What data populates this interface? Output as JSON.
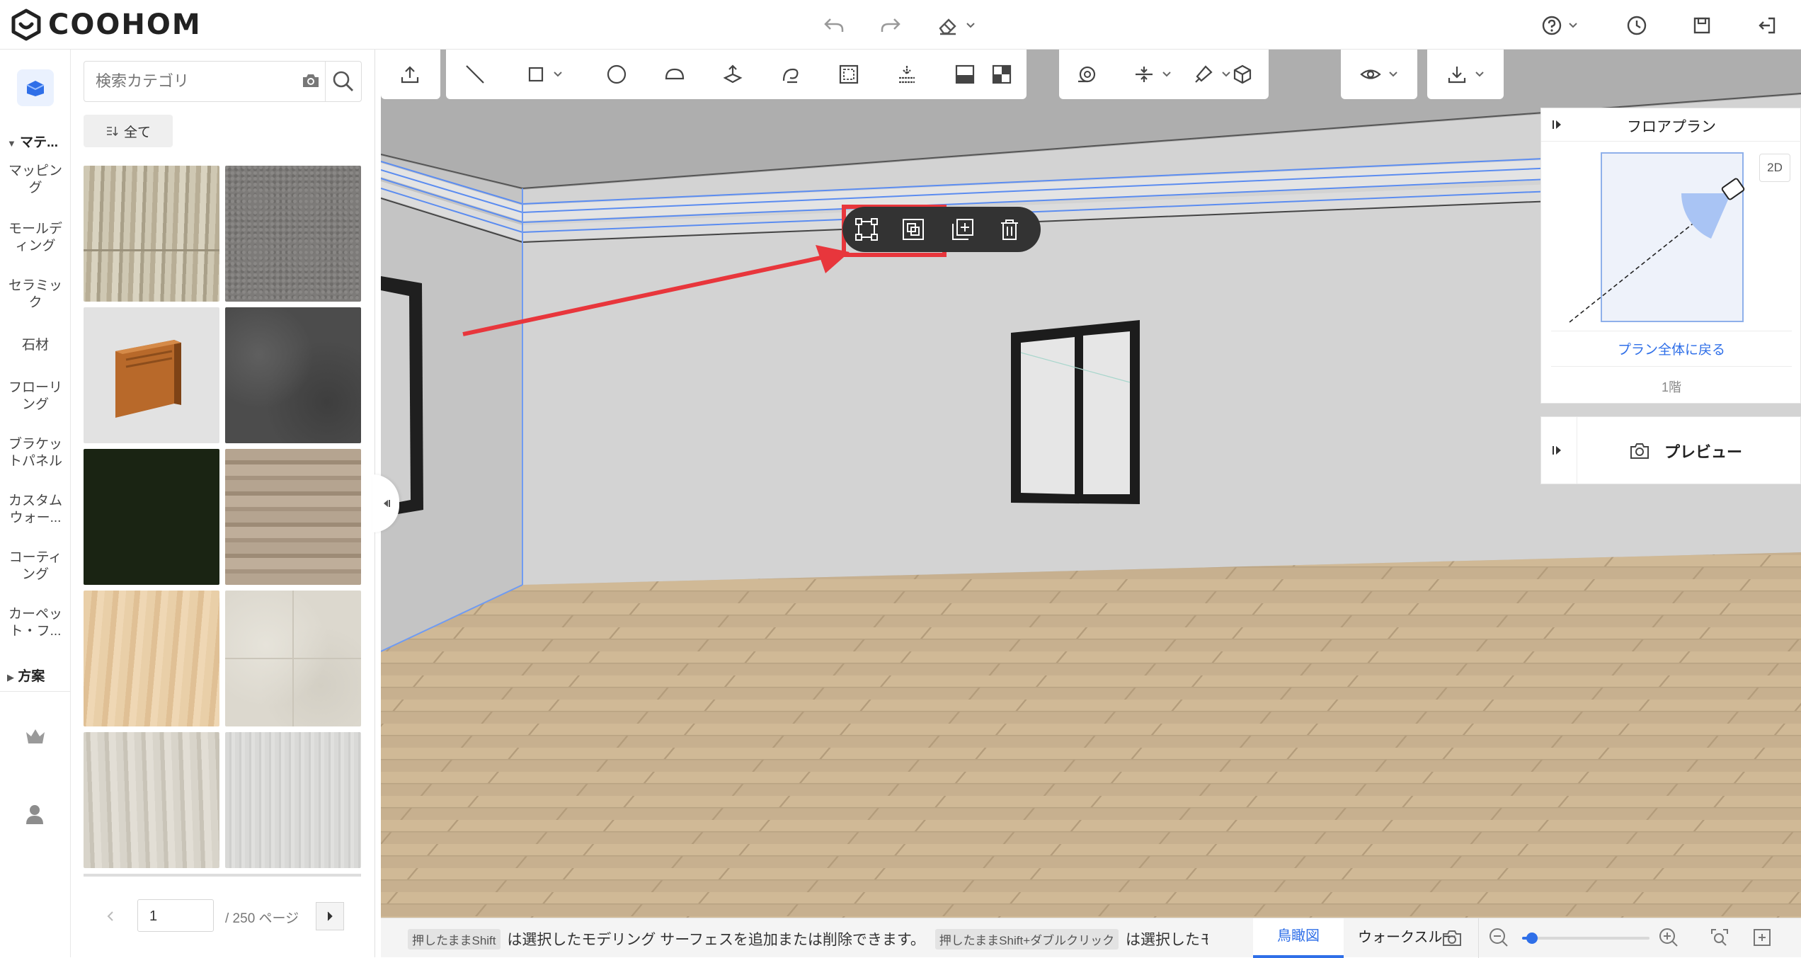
{
  "app": {
    "logo_text": "COOHOM"
  },
  "topbar": {
    "icons": [
      "undo-icon",
      "redo-icon",
      "eraser-icon",
      "help-icon",
      "history-icon",
      "save-icon",
      "exit-icon"
    ]
  },
  "rail": {
    "sections": [
      {
        "label": "マテ...",
        "items": [
          "マッピング",
          "モールディング",
          "セラミック",
          "石材",
          "フローリング",
          "ブラケットパネル",
          "カスタムウォー...",
          "コーティング",
          "カーペット・フ..."
        ]
      },
      {
        "label": "方案"
      }
    ]
  },
  "panel": {
    "search_placeholder": "検索カテゴリ",
    "all_label": "全て",
    "pager": {
      "current": "1",
      "total": "/ 250 ページ"
    }
  },
  "floorplan": {
    "title": "フロアプラン",
    "mode_2d": "2D",
    "back_link": "プラン全体に戻る",
    "floor_label": "1階"
  },
  "preview": {
    "label": "プレビュー"
  },
  "status": {
    "key1": "押したままShift",
    "text1": "は選択したモデリング サーフェスを追加または削除できます。",
    "key2": "押したままShift+ダブルクリック",
    "text2": "は選択したモ",
    "tab_birdseye": "鳥瞰図",
    "tab_walkthrough": "ウォークスルー",
    "zoom_level": 0.08
  },
  "colors": {
    "accent": "#2f6fe8",
    "highlight": "#e8363c",
    "wall": "#cfcfcf",
    "floor": "#c7b08f"
  }
}
